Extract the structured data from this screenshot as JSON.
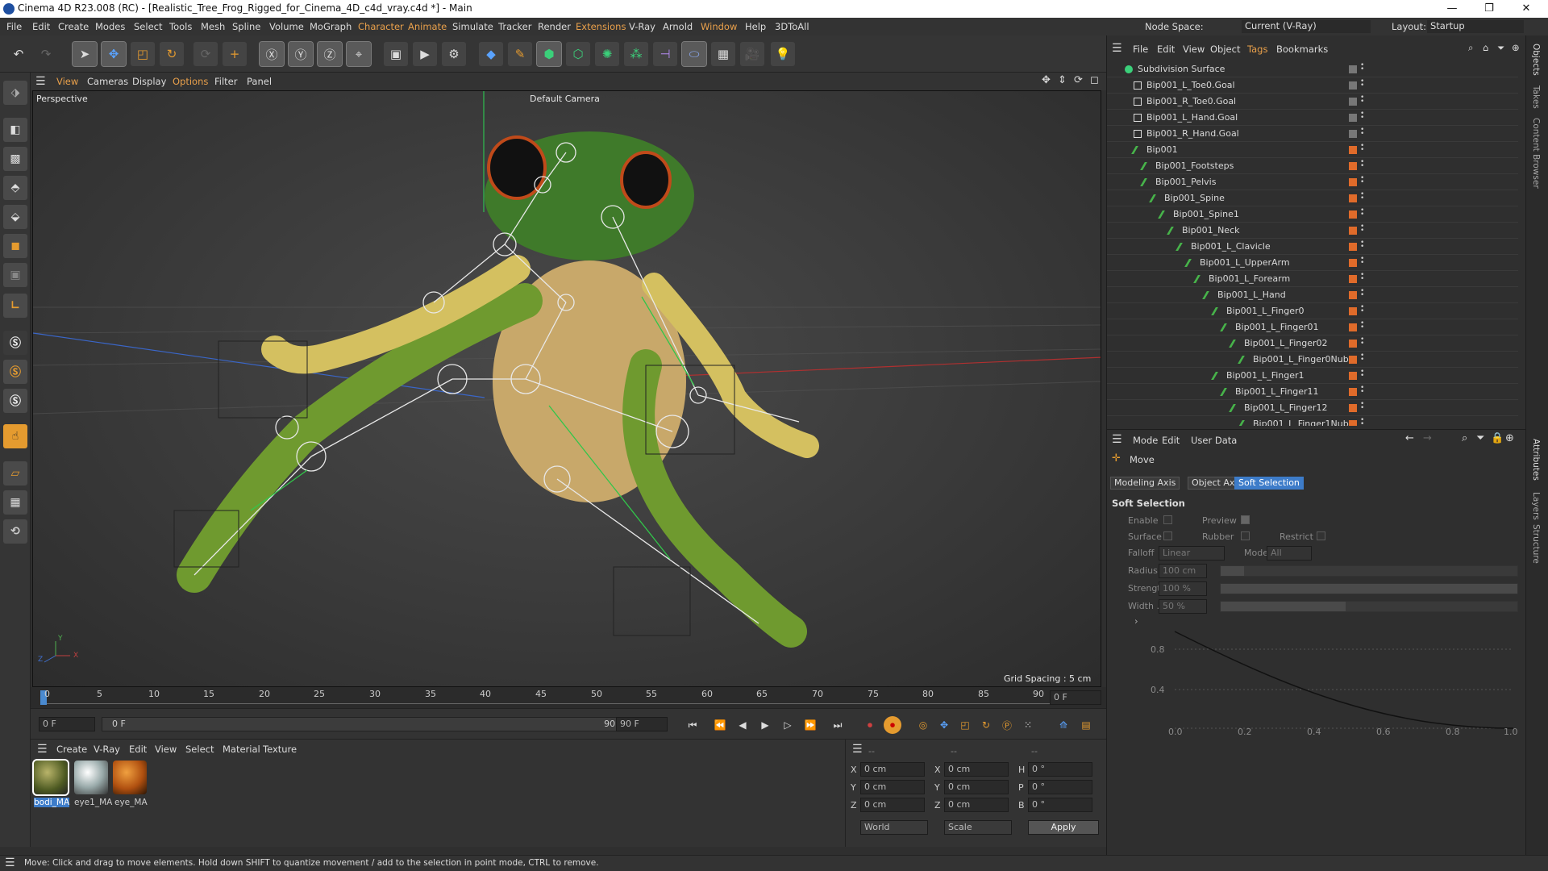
{
  "titlebar": {
    "title": "Cinema 4D R23.008 (RC) - [Realistic_Tree_Frog_Rigged_for_Cinema_4D_c4d_vray.c4d *] - Main",
    "minimize": "—",
    "maximize": "❐",
    "close": "✕"
  },
  "menu": {
    "items": [
      "File",
      "Edit",
      "Create",
      "Modes",
      "Select",
      "Tools",
      "Mesh",
      "Spline",
      "Volume",
      "MoGraph",
      "Character",
      "Animate",
      "Simulate",
      "Tracker",
      "Render",
      "Extensions",
      "V-Ray",
      "Arnold",
      "Window",
      "Help",
      "3DToAll"
    ],
    "node_space_label": "Node Space:",
    "node_space_value": "Current (V-Ray)",
    "layout_label": "Layout:",
    "layout_value": "Startup"
  },
  "viewport_menu": [
    "View",
    "Cameras",
    "Display",
    "Options",
    "Filter",
    "Panel"
  ],
  "viewport": {
    "name": "Perspective",
    "camera": "Default Camera",
    "grid_spacing": "Grid Spacing : 5 cm",
    "axis_y": "Y",
    "axis_x": "X",
    "axis_z": "Z"
  },
  "timeline": {
    "ticks": [
      "0",
      "5",
      "10",
      "15",
      "20",
      "25",
      "30",
      "35",
      "40",
      "45",
      "50",
      "55",
      "60",
      "65",
      "70",
      "75",
      "80",
      "85",
      "90"
    ],
    "frame_field": "0 F"
  },
  "transport": {
    "start": "0 F",
    "range_start": "0 F",
    "range_end": "90 F",
    "end": "90 F"
  },
  "material_manager": {
    "menu": [
      "Create",
      "V-Ray",
      "Edit",
      "View",
      "Select",
      "Material",
      "Texture"
    ],
    "materials": [
      {
        "name": "bodi_MA"
      },
      {
        "name": "eye1_MA"
      },
      {
        "name": "eye_MA"
      }
    ]
  },
  "coords": {
    "header1": "--",
    "header2": "--",
    "header3": "--",
    "rows": [
      {
        "a": "X",
        "av": "0 cm",
        "b": "X",
        "bv": "0 cm",
        "c": "H",
        "cv": "0 °"
      },
      {
        "a": "Y",
        "av": "0 cm",
        "b": "Y",
        "bv": "0 cm",
        "c": "P",
        "cv": "0 °"
      },
      {
        "a": "Z",
        "av": "0 cm",
        "b": "Z",
        "bv": "0 cm",
        "c": "B",
        "cv": "0 °"
      }
    ],
    "world": "World",
    "scale": "Scale",
    "apply": "Apply"
  },
  "status": "Move: Click and drag to move elements. Hold down SHIFT to quantize movement / add to the selection in point mode, CTRL to remove.",
  "objects": {
    "menu": [
      "File",
      "Edit",
      "View",
      "Object",
      "Tags",
      "Bookmarks"
    ],
    "rows": [
      {
        "name": "Subdivision Surface",
        "indent": 0
      },
      {
        "name": "Bip001_L_Toe0.Goal",
        "indent": 1
      },
      {
        "name": "Bip001_R_Toe0.Goal",
        "indent": 1
      },
      {
        "name": "Bip001_L_Hand.Goal",
        "indent": 1
      },
      {
        "name": "Bip001_R_Hand.Goal",
        "indent": 1
      },
      {
        "name": "Bip001",
        "indent": 1
      },
      {
        "name": "Bip001_Footsteps",
        "indent": 2
      },
      {
        "name": "Bip001_Pelvis",
        "indent": 2
      },
      {
        "name": "Bip001_Spine",
        "indent": 3
      },
      {
        "name": "Bip001_Spine1",
        "indent": 4
      },
      {
        "name": "Bip001_Neck",
        "indent": 5
      },
      {
        "name": "Bip001_L_Clavicle",
        "indent": 6
      },
      {
        "name": "Bip001_L_UpperArm",
        "indent": 7
      },
      {
        "name": "Bip001_L_Forearm",
        "indent": 8
      },
      {
        "name": "Bip001_L_Hand",
        "indent": 9
      },
      {
        "name": "Bip001_L_Finger0",
        "indent": 10
      },
      {
        "name": "Bip001_L_Finger01",
        "indent": 11
      },
      {
        "name": "Bip001_L_Finger02",
        "indent": 12
      },
      {
        "name": "Bip001_L_Finger0Nub",
        "indent": 13
      },
      {
        "name": "Bip001_L_Finger1",
        "indent": 10
      },
      {
        "name": "Bip001_L_Finger11",
        "indent": 11
      },
      {
        "name": "Bip001_L_Finger12",
        "indent": 12
      },
      {
        "name": "Bip001_L_Finger1Nub",
        "indent": 13
      }
    ]
  },
  "attributes": {
    "menu": [
      "Mode",
      "Edit",
      "User Data"
    ],
    "tool": "Move",
    "tabs": [
      "Modeling Axis",
      "Object Axis",
      "Soft Selection"
    ],
    "section": "Soft Selection",
    "enable": "Enable",
    "preview": "Preview",
    "surface": "Surface",
    "rubber": "Rubber",
    "restrict": "Restrict",
    "falloff": "Falloff",
    "falloff_value": "Linear",
    "mode": "Mode",
    "mode_value": "All",
    "radius": "Radius",
    "radius_value": "100 cm",
    "strength": "Strength",
    "strength_value": "100 %",
    "width": "Width . .",
    "width_value": "50 %",
    "graph_y": [
      "0.8",
      "0.4"
    ],
    "graph_x": [
      "0.0",
      "0.2",
      "0.4",
      "0.6",
      "0.8",
      "1.0"
    ]
  },
  "right_tabs": [
    "Objects",
    "Takes",
    "Content Browser",
    "Attributes",
    "Layers",
    "Structure"
  ]
}
